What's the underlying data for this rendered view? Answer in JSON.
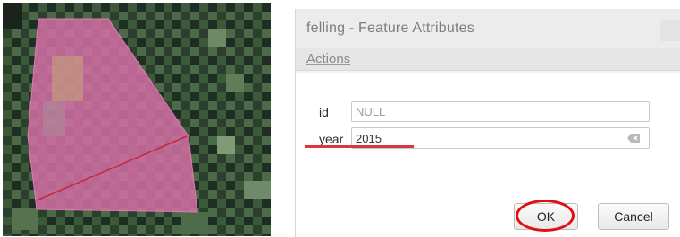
{
  "dialog": {
    "title": "felling - Feature Attributes",
    "menu": {
      "actions_label": "Actions"
    },
    "fields": [
      {
        "label": "id",
        "value": "NULL"
      },
      {
        "label": "year",
        "value": "2015"
      }
    ],
    "buttons": {
      "ok_label": "OK",
      "cancel_label": "Cancel"
    }
  },
  "icons": {
    "clear": "clear-text-icon",
    "close": "close-icon"
  },
  "colors": {
    "annotation_red": "#e01010",
    "polygon_fill": "#d36fa6"
  }
}
